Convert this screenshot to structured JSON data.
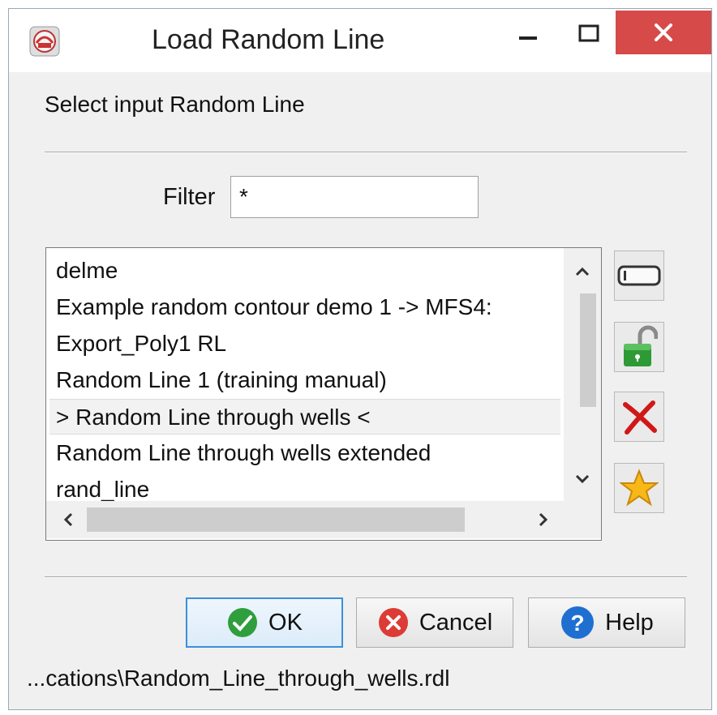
{
  "window": {
    "title": "Load Random Line",
    "icon": "app-logo-icon",
    "controls": [
      "minimize-icon",
      "maximize-icon",
      "close-icon"
    ]
  },
  "prompt": "Select input Random Line",
  "filter": {
    "label": "Filter",
    "value": "*"
  },
  "list": {
    "items": [
      "delme",
      "Example random contour demo 1 -> MFS4:",
      "Export_Poly1 RL",
      "Random Line 1 (training manual)",
      "> Random Line through wells <",
      "Random Line through wells extended",
      "rand_line"
    ],
    "selected_index": 4
  },
  "side_buttons": [
    {
      "name": "rename-button",
      "icon": "rename-field-icon"
    },
    {
      "name": "unlock-button",
      "icon": "unlock-icon"
    },
    {
      "name": "delete-button",
      "icon": "delete-x-icon"
    },
    {
      "name": "favorite-button",
      "icon": "star-icon"
    }
  ],
  "buttons": {
    "ok": "OK",
    "cancel": "Cancel",
    "help": "Help"
  },
  "status_path": "...cations\\Random_Line_through_wells.rdl",
  "colors": {
    "close_bg": "#d64a4a",
    "ok_border": "#3c8fd9",
    "selection": "#f2f2f2"
  }
}
